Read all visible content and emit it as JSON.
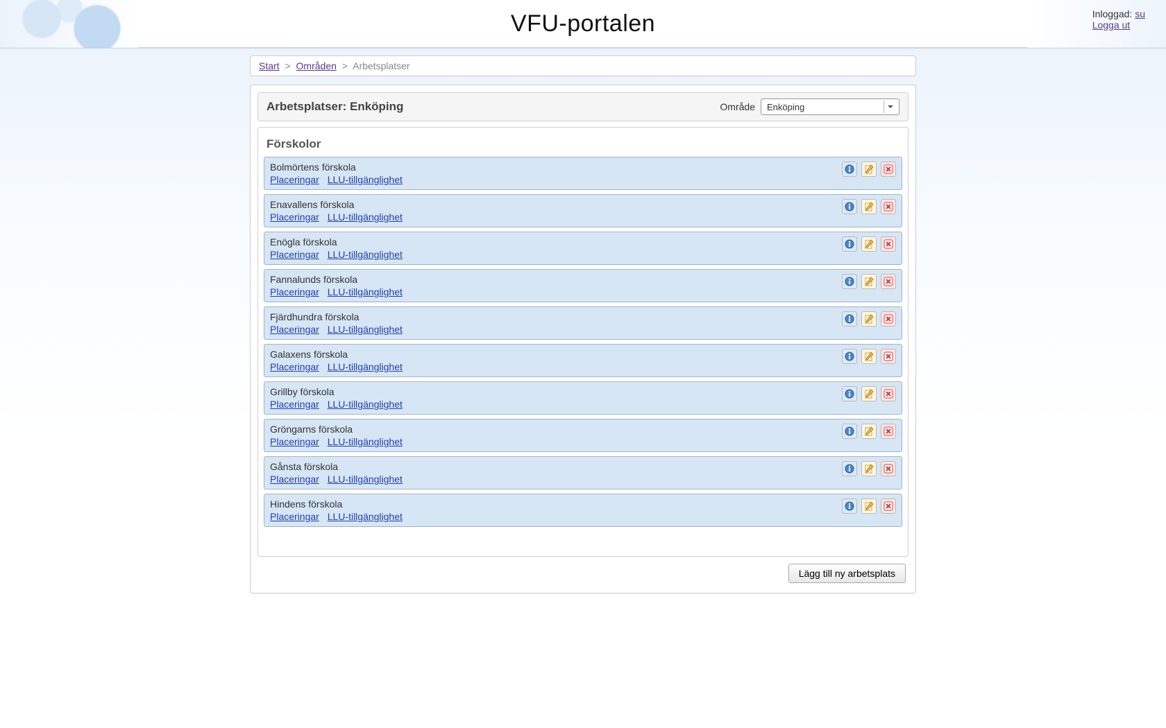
{
  "header": {
    "title": "VFU-portalen",
    "logged_in_label": "Inloggad:",
    "user": "su",
    "logout": "Logga ut"
  },
  "breadcrumb": {
    "start": "Start",
    "areas": "Områden",
    "current": "Arbetsplatser",
    "sep": ">"
  },
  "section": {
    "title": "Arbetsplatser: Enköping",
    "area_label": "Område",
    "area_selected": "Enköping"
  },
  "category": {
    "title": "Förskolor"
  },
  "link_labels": {
    "placeringar": "Placeringar",
    "llu": "LLU-tillgänglighet"
  },
  "items": [
    {
      "name": "Bolmörtens förskola"
    },
    {
      "name": "Enavallens förskola"
    },
    {
      "name": "Enögla förskola"
    },
    {
      "name": "Fannalunds förskola"
    },
    {
      "name": "Fjärdhundra förskola"
    },
    {
      "name": "Galaxens förskola"
    },
    {
      "name": "Grillby förskola"
    },
    {
      "name": "Gröngarns förskola"
    },
    {
      "name": "Gånsta förskola"
    },
    {
      "name": "Hindens förskola"
    }
  ],
  "footer": {
    "add_button": "Lägg till ny arbetsplats"
  }
}
